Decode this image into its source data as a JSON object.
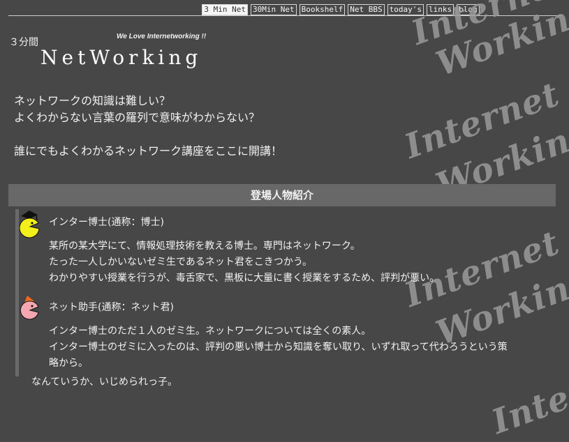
{
  "nav": {
    "items": [
      "3 Min Net",
      "30Min Net",
      "Bookshelf",
      "Net BBS",
      "today's",
      "links",
      "blog"
    ],
    "active_index": 0
  },
  "watermark": {
    "line1": "Internet",
    "line2": "Working"
  },
  "header": {
    "brand_small": "３分間",
    "tagline": "We Love Internetworking !!",
    "logo": "NetWorking"
  },
  "intro": {
    "line1": "ネットワークの知識は難しい？",
    "line2": "よくわからない言葉の羅列で意味がわからない？",
    "line3": "誰にでもよくわかるネットワーク講座をここに開講！"
  },
  "characters_section": {
    "title": "登場人物紹介",
    "characters": [
      {
        "name": "インター博士(通称：博士)",
        "icon": "professor-pacman-icon",
        "color": "#f3ef1a",
        "desc": [
          "某所の某大学にて、情報処理技術を教える博士。専門はネットワーク。",
          "たった一人しかいないゼミ生であるネット君をこきつかう。",
          "わかりやすい授業を行うが、毒舌家で、黒板に大量に書く授業をするため、評判が悪い。"
        ]
      },
      {
        "name": "ネット助手(通称：ネット君)",
        "icon": "assistant-pacman-icon",
        "color": "#f4a7b0",
        "desc": [
          "インター博士のただ１人のゼミ生。ネットワークについては全くの素人。",
          "インター博士のゼミに入ったのは、評判の悪い博士から知識を奪い取り、いずれ取って代わろうという策",
          "略から。"
        ]
      }
    ],
    "footer_line": "なんていうか、いじめられっ子。"
  }
}
